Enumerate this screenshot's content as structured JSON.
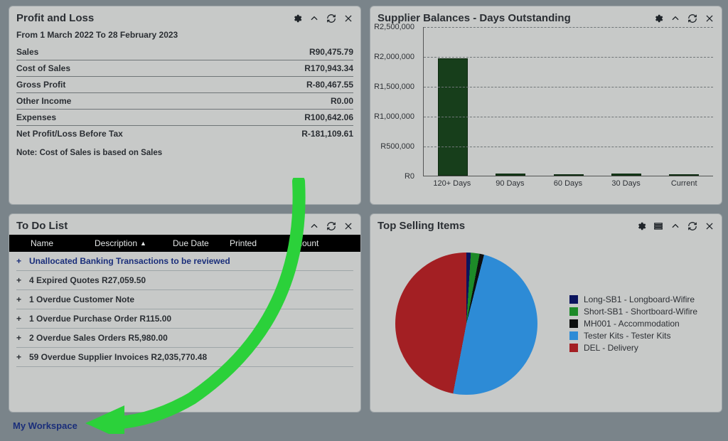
{
  "pnl": {
    "title": "Profit and Loss",
    "date_range": "From 1 March 2022 To 28 February 2023",
    "rows": [
      {
        "label": "Sales",
        "value": "R90,475.79"
      },
      {
        "label": "Cost of Sales",
        "value": "R170,943.34"
      },
      {
        "label": "Gross Profit",
        "value": "R-80,467.55"
      },
      {
        "label": "Other Income",
        "value": "R0.00"
      },
      {
        "label": "Expenses",
        "value": "R100,642.06"
      },
      {
        "label": "Net Profit/Loss Before Tax",
        "value": "R-181,109.61"
      }
    ],
    "note_label": "Note:",
    "note_text": "Cost of Sales is based on Sales"
  },
  "supplier": {
    "title": "Supplier Balances - Days Outstanding"
  },
  "todo": {
    "title": "To Do List",
    "columns": {
      "name": "Name",
      "description": "Description",
      "due": "Due Date",
      "printed": "Printed",
      "amount": "Amount"
    },
    "items": [
      "Unallocated Banking Transactions to be reviewed",
      "4 Expired Quotes R27,059.50",
      "1 Overdue Customer Note",
      "1 Overdue Purchase Order R115.00",
      "2 Overdue Sales Orders R5,980.00",
      "59 Overdue Supplier Invoices R2,035,770.48"
    ]
  },
  "top_selling": {
    "title": "Top Selling Items",
    "legend": [
      {
        "label": "Long-SB1 - Longboard-Wifire",
        "color": "#0b145e"
      },
      {
        "label": "Short-SB1 - Shortboard-Wifire",
        "color": "#1d8a28"
      },
      {
        "label": "MH001 - Accommodation",
        "color": "#0d0f0e"
      },
      {
        "label": "Tester Kits - Tester Kits",
        "color": "#2d8bd6"
      },
      {
        "label": "DEL - Delivery",
        "color": "#a31f23"
      }
    ]
  },
  "workspace_label": "My Workspace",
  "chart_data": [
    {
      "type": "bar",
      "title": "Supplier Balances - Days Outstanding",
      "categories": [
        "120+ Days",
        "90 Days",
        "60 Days",
        "30 Days",
        "Current"
      ],
      "values": [
        1960000,
        40000,
        15000,
        30000,
        0
      ],
      "ylabel": "",
      "ylim": [
        0,
        2500000
      ],
      "y_ticks": [
        "R0",
        "R500,000",
        "R1,000,000",
        "R1,500,000",
        "R2,000,000",
        "R2,500,000"
      ]
    },
    {
      "type": "pie",
      "title": "Top Selling Items",
      "series": [
        {
          "name": "Long-SB1 - Longboard-Wifire",
          "value": 1,
          "color": "#0b145e"
        },
        {
          "name": "Short-SB1 - Shortboard-Wifire",
          "value": 2,
          "color": "#1d8a28"
        },
        {
          "name": "MH001 - Accommodation",
          "value": 1,
          "color": "#0d0f0e"
        },
        {
          "name": "Tester Kits - Tester Kits",
          "value": 49,
          "color": "#2d8bd6"
        },
        {
          "name": "DEL - Delivery",
          "value": 47,
          "color": "#a31f23"
        }
      ]
    }
  ]
}
